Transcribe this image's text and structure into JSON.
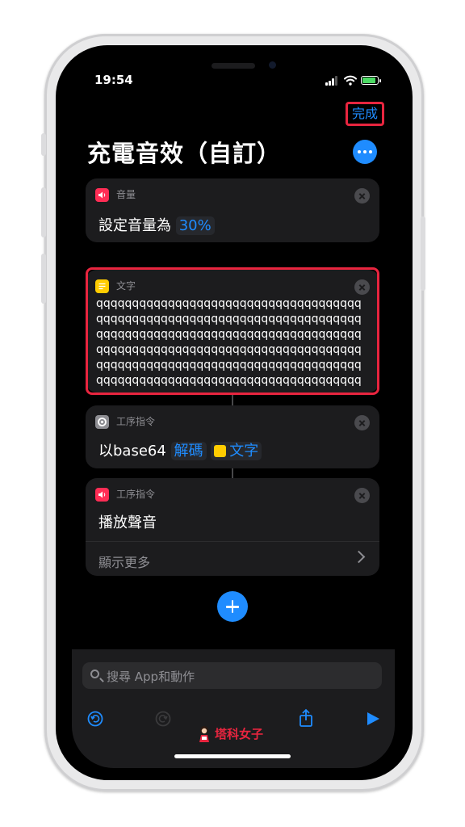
{
  "status": {
    "time": "19:54"
  },
  "header": {
    "done_label": "完成",
    "title": "充電音效（自訂）"
  },
  "actions": [
    {
      "app": "音量",
      "text": "設定音量為",
      "value": "30%"
    },
    {
      "app": "文字",
      "content": "qqqqqqqqqqqqqqqqqqqqqqqqqqqqqqqqqqqqqqqqqqqqqqqqqqqqqqqqqqqqqqqqqqqqqqqqqqqqqqqqqqqqqqqqqqqqqqqqqqqqqqqqqqqqqqqqqqqqqqqqqqqqqqqqqqqqqqqqqqqqqqqqqqqqqqqqqqqqqqqqqqqqqqqqqqqqqqqqqqqqqqqqqqqqqqqqqqqqqqqqqqqqqqqqqqqqqqqqqqqqqqqqqqqqqqqqqqqqqqqq"
    },
    {
      "app": "工序指令",
      "prefix": "以base64",
      "method": "解碼",
      "input": "文字"
    },
    {
      "app": "工序指令",
      "text": "播放聲音",
      "show_more": "顯示更多"
    }
  ],
  "search": {
    "placeholder": "搜尋 App和動作"
  },
  "watermark": "塔科女子",
  "colors": {
    "accent": "#1f8cff",
    "highlight": "#e8253f",
    "card": "#1c1c1e"
  },
  "icons": [
    "speaker-icon",
    "text-icon",
    "gear-icon",
    "close-icon",
    "more-icon",
    "add-icon",
    "search-icon",
    "undo-icon",
    "redo-icon",
    "share-icon",
    "play-icon"
  ]
}
